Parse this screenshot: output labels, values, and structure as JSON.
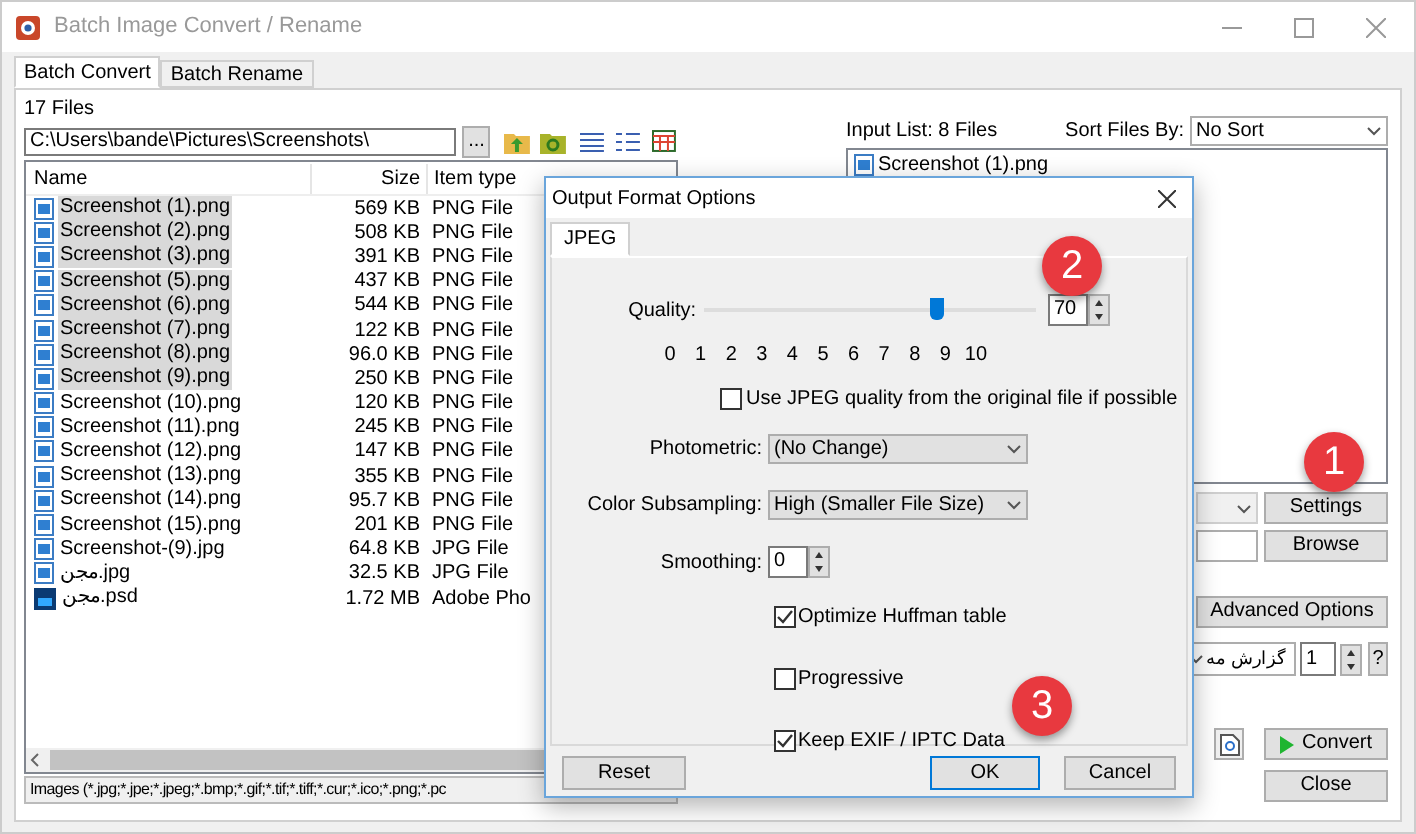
{
  "window": {
    "title": "Batch Image Convert / Rename"
  },
  "tabs": [
    {
      "label": "Batch Convert",
      "selected": true
    },
    {
      "label": "Batch Rename",
      "selected": false
    }
  ],
  "files_panel": {
    "count": "17 Files",
    "path": "C:\\Users\\bande\\Pictures\\Screenshots\\",
    "browse": "...",
    "columns": [
      "Name",
      "Size",
      "Item type"
    ],
    "files": [
      {
        "name": "Screenshot (1).png",
        "size": "569 KB",
        "type": "PNG File",
        "kind": "image",
        "selected": true
      },
      {
        "name": "Screenshot (2).png",
        "size": "508 KB",
        "type": "PNG File",
        "kind": "image",
        "selected": true
      },
      {
        "name": "Screenshot (3).png",
        "size": "391 KB",
        "type": "PNG File",
        "kind": "image",
        "selected": true
      },
      {
        "name": "Screenshot (5).png",
        "size": "437 KB",
        "type": "PNG File",
        "kind": "image",
        "selected": true
      },
      {
        "name": "Screenshot (6).png",
        "size": "544 KB",
        "type": "PNG File",
        "kind": "image",
        "selected": true
      },
      {
        "name": "Screenshot (7).png",
        "size": "122 KB",
        "type": "PNG File",
        "kind": "image",
        "selected": true
      },
      {
        "name": "Screenshot (8).png",
        "size": "96.0 KB",
        "type": "PNG File",
        "kind": "image",
        "selected": true
      },
      {
        "name": "Screenshot (9).png",
        "size": "250 KB",
        "type": "PNG File",
        "kind": "image",
        "selected": true
      },
      {
        "name": "Screenshot (10).png",
        "size": "120 KB",
        "type": "PNG File",
        "kind": "image",
        "selected": false
      },
      {
        "name": "Screenshot (11).png",
        "size": "245 KB",
        "type": "PNG File",
        "kind": "image",
        "selected": false
      },
      {
        "name": "Screenshot (12).png",
        "size": "147 KB",
        "type": "PNG File",
        "kind": "image",
        "selected": false
      },
      {
        "name": "Screenshot (13).png",
        "size": "355 KB",
        "type": "PNG File",
        "kind": "image",
        "selected": false
      },
      {
        "name": "Screenshot (14).png",
        "size": "95.7 KB",
        "type": "PNG File",
        "kind": "image",
        "selected": false
      },
      {
        "name": "Screenshot (15).png",
        "size": "201 KB",
        "type": "PNG File",
        "kind": "image",
        "selected": false
      },
      {
        "name": "Screenshot-(9).jpg",
        "size": "64.8 KB",
        "type": "JPG File",
        "kind": "image",
        "selected": false
      },
      {
        "name": "مجن.jpg",
        "size": "32.5 KB",
        "type": "JPG File",
        "kind": "image",
        "selected": false
      },
      {
        "name": "مجن.psd",
        "size": "1.72 MB",
        "type": "Adobe Pho",
        "kind": "photoshop",
        "selected": false
      }
    ],
    "filter": "Images (*.jpg;*.jpe;*.jpeg;*.bmp;*.gif;*.tif;*.tiff;*.cur;*.ico;*.png;*.pc"
  },
  "input_panel": {
    "label": "Input List: 8 Files",
    "sort_label": "Sort Files By:",
    "sort_value": "No Sort",
    "items": [
      "Screenshot (1).png"
    ],
    "settings": "Settings",
    "browse": "Browse",
    "advanced": "Advanced Options",
    "language": "گزارش مه",
    "copies": "1",
    "help": "?",
    "convert": "Convert",
    "close": "Close"
  },
  "dialog": {
    "title": "Output Format Options",
    "tab": "JPEG",
    "quality_label": "Quality:",
    "quality": {
      "level": 0.7
    },
    "quality_value": "70",
    "ticks": [
      "0",
      "1",
      "2",
      "3",
      "4",
      "5",
      "6",
      "7",
      "8",
      "9",
      "10"
    ],
    "use_original": {
      "label": "Use JPEG quality from the original file if possible",
      "checked": false
    },
    "photometric_label": "Photometric:",
    "photometric": "(No Change)",
    "subsampling_label": "Color Subsampling:",
    "subsampling": "High (Smaller File Size)",
    "smoothing_label": "Smoothing:",
    "smoothing": "0",
    "options": [
      {
        "label": "Optimize Huffman table",
        "checked": true
      },
      {
        "label": "Progressive",
        "checked": false
      },
      {
        "label": "Keep EXIF / IPTC Data",
        "checked": true
      }
    ],
    "buttons": [
      "Reset",
      "OK",
      "Cancel"
    ]
  },
  "badges": [
    "1",
    "2",
    "3"
  ]
}
